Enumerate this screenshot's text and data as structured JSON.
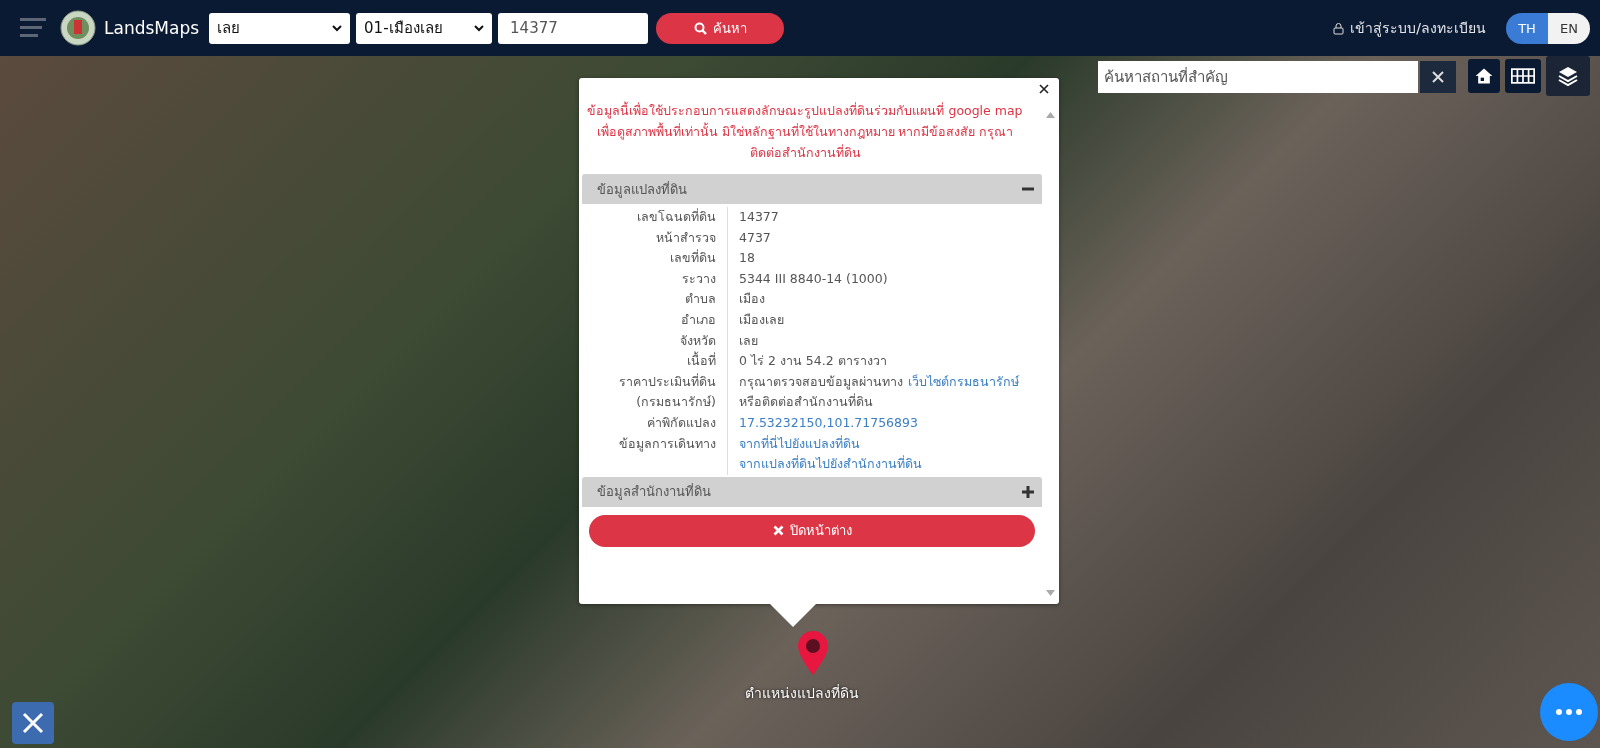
{
  "header": {
    "brand": "LandsMaps",
    "province": "เลย",
    "district": "01-เมืองเลย",
    "parcel_number": "14377",
    "search_button": "ค้นหา",
    "login": "เข้าสู่ระบบ/ลงทะเบียน",
    "languages": [
      {
        "label": "TH",
        "selected": true
      },
      {
        "label": "EN",
        "selected": false
      }
    ]
  },
  "map": {
    "place_search": {
      "placeholder": "ค้นหาสถานที่สำคัญ"
    },
    "marker_label": "ตำแหน่งแปลงที่ดิน"
  },
  "popup": {
    "notice": "ข้อมูลนี้เพื่อใช้ประกอบการแสดงลักษณะรูปแปลงที่ดินร่วมกับแผนที่ google map เพื่อดูสภาพพื้นที่เท่านั้น มิใช่หลักฐานที่ใช้ในทางกฎหมาย หากมีข้อสงสัย กรุณาติดต่อสำนักงานที่ดิน",
    "sections": [
      {
        "title": "ข้อมูลแปลงที่ดิน",
        "expanded": true,
        "rows": [
          {
            "label": "เลขโฉนดที่ดิน",
            "value": [
              {
                "text": "14377",
                "link": false
              }
            ]
          },
          {
            "label": "หน้าสำรวจ",
            "value": [
              {
                "text": "4737",
                "link": false
              }
            ]
          },
          {
            "label": "เลขที่ดิน",
            "value": [
              {
                "text": "18",
                "link": false
              }
            ]
          },
          {
            "label": "ระวาง",
            "value": [
              {
                "text": "5344 III 8840-14 (1000)",
                "link": false
              }
            ]
          },
          {
            "label": "ตำบล",
            "value": [
              {
                "text": "เมือง",
                "link": false
              }
            ]
          },
          {
            "label": "อำเภอ",
            "value": [
              {
                "text": "เมืองเลย",
                "link": false
              }
            ]
          },
          {
            "label": "จังหวัด",
            "value": [
              {
                "text": "เลย",
                "link": false
              }
            ]
          },
          {
            "label": "เนื้อที่",
            "value": [
              {
                "text": "0 ไร่ 2 งาน 54.2 ตารางวา",
                "link": false
              }
            ]
          },
          {
            "label": "ราคาประเมินที่ดิน",
            "value": [
              {
                "text": "กรุณาตรวจสอบข้อมูลผ่านทาง",
                "link": false
              },
              {
                "text": "เว็บไซต์กรมธนารักษ์",
                "link": true
              }
            ]
          },
          {
            "label": "(กรมธนารักษ์)",
            "value": [
              {
                "text": "หรือติดต่อสำนักงานที่ดิน",
                "link": false
              }
            ]
          },
          {
            "label": "ค่าพิกัดแปลง",
            "value": [
              {
                "text": "17.53232150,101.71756893",
                "link": true
              }
            ]
          },
          {
            "label": "ข้อมูลการเดินทาง",
            "value": [
              {
                "text": "จากที่นี่ไปยังแปลงที่ดิน",
                "link": true
              }
            ]
          },
          {
            "value": [
              {
                "text": "จากแปลงที่ดินไปยังสำนักงานที่ดิน",
                "link": true
              }
            ]
          }
        ]
      },
      {
        "title": "ข้อมูลสำนักงานที่ดิน",
        "expanded": false
      }
    ],
    "close_button": "ปิดหน้าต่าง"
  }
}
